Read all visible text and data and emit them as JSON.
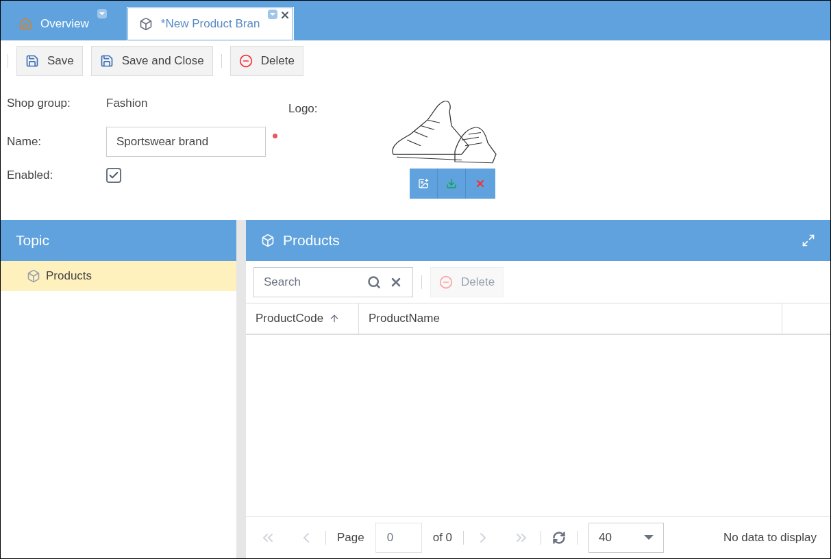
{
  "tabs": [
    {
      "label": "Overview",
      "kind": "home",
      "selected": false,
      "closable": false
    },
    {
      "label": "*New Product Bran",
      "kind": "brick",
      "selected": true,
      "closable": true
    }
  ],
  "toolbar": [
    {
      "label": "Save",
      "kind": "save"
    },
    {
      "label": "Save and Close",
      "kind": "save"
    },
    {
      "label": "Delete",
      "kind": "delete"
    }
  ],
  "form": {
    "shop_group": {
      "label": "Shop group:",
      "value": "Fashion"
    },
    "name": {
      "label": "Name:",
      "value": "Sportswear brand",
      "required": true
    },
    "enabled": {
      "label": "Enabled:",
      "checked": true
    },
    "logo": {
      "label": "Logo:"
    }
  },
  "topic": {
    "title": "Topic",
    "items": [
      {
        "label": "Products",
        "selected": true
      }
    ]
  },
  "products": {
    "title": "Products",
    "search": {
      "placeholder": "Search"
    },
    "delete": {
      "label": "Delete",
      "disabled": true
    },
    "columns": [
      {
        "label": "ProductCode",
        "sorted": true
      },
      {
        "label": "ProductName",
        "sorted": false
      }
    ],
    "pager": {
      "page_label": "Page",
      "page": "0",
      "of": "of 0",
      "page_size": "40",
      "status": "No data to display"
    }
  }
}
